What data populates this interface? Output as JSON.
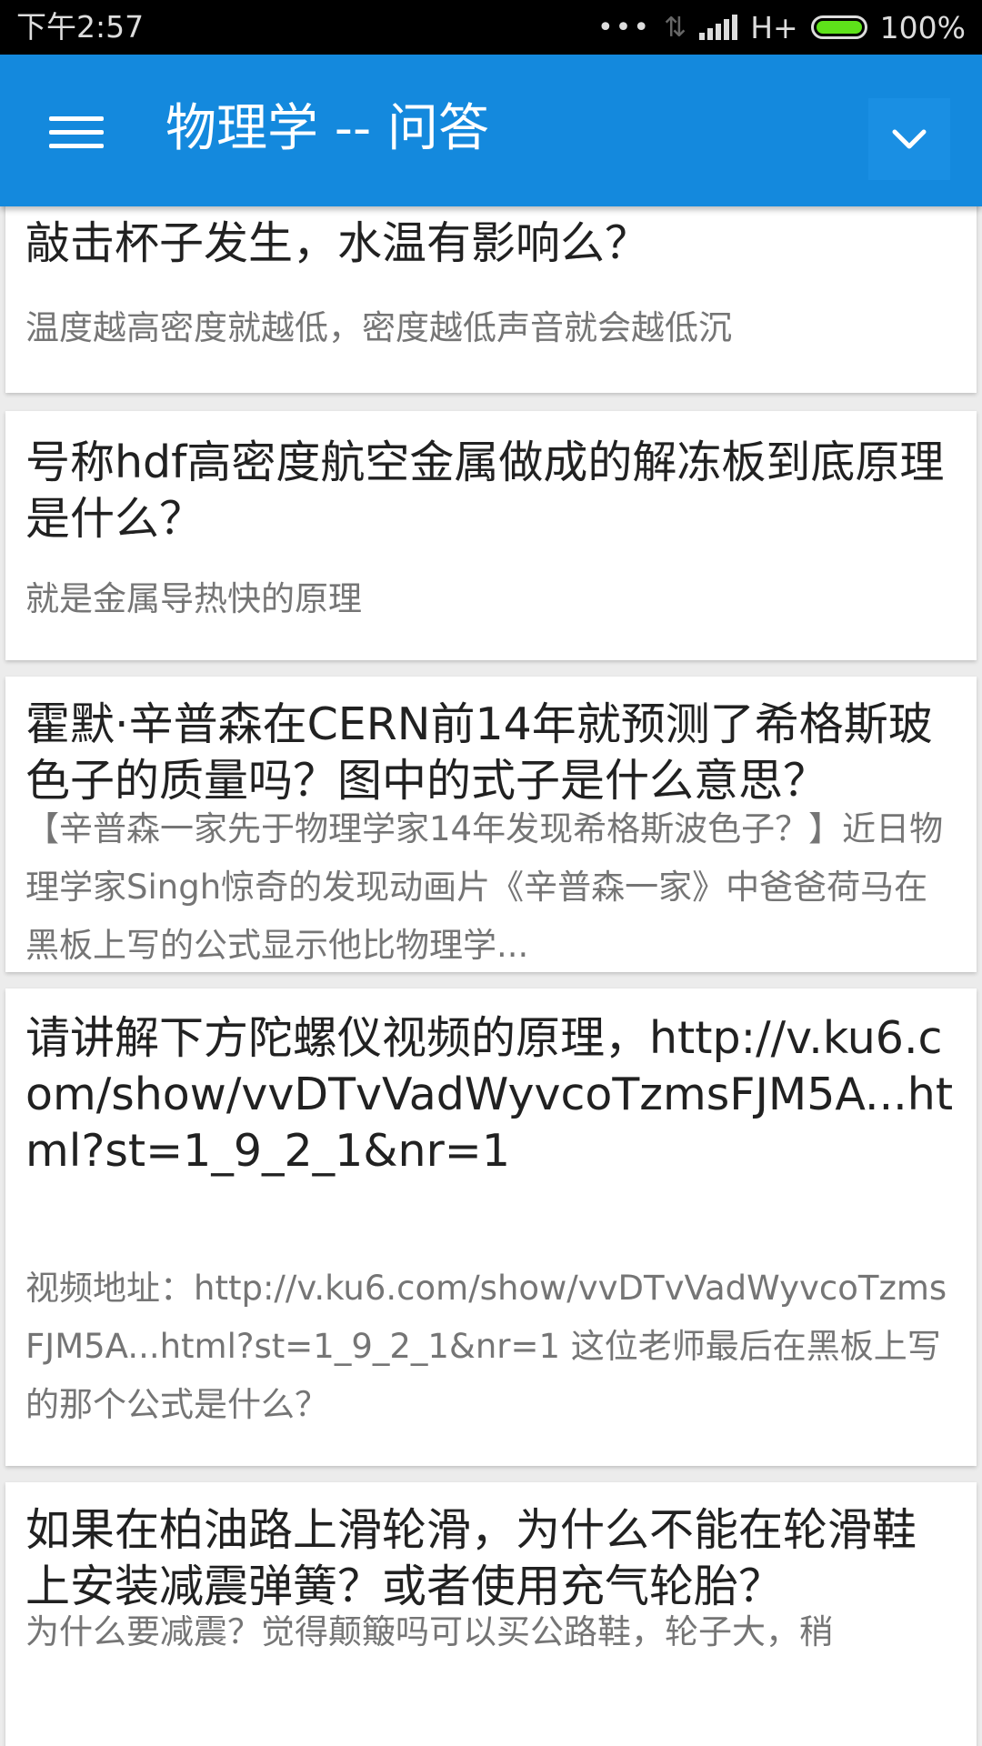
{
  "status_bar": {
    "time": "下午2:57",
    "network": "H+",
    "battery": "100%",
    "battery_level": 1.0
  },
  "app_bar": {
    "title": "物理学 -- 问答",
    "menu_icon": "hamburger-menu",
    "dropdown_icon": "chevron-down"
  },
  "questions": [
    {
      "title": "敲击杯子发生，水温有影响么？",
      "summary": "温度越高密度就越低，密度越低声音就会越低沉"
    },
    {
      "title": "号称hdf高密度航空金属做成的解冻板到底原理是什么？",
      "summary": "就是金属导热快的原理"
    },
    {
      "title": "霍默·辛普森在CERN前14年就预测了希格斯玻色子的质量吗？图中的式子是什么意思？",
      "summary": "【辛普森一家先于物理学家14年发现希格斯波色子？】近日物理学家Singh惊奇的发现动画片《辛普森一家》中爸爸荷马在黑板上写的公式显示他比物理学..."
    },
    {
      "title": "请讲解下方陀螺仪视频的原理，http://v.ku6.com/show/vvDTvVadWyvcoTzmsFJM5A...html?st=1_9_2_1&nr=1",
      "summary": "视频地址：http://v.ku6.com/show/vvDTvVadWyvcoTzmsFJM5A...html?st=1_9_2_1&nr=1 这位老师最后在黑板上写的那个公式是什么？"
    },
    {
      "title": "如果在柏油路上滑轮滑，为什么不能在轮滑鞋上安装减震弹簧？或者使用充气轮胎？",
      "summary": "为什么要减震？觉得颠簸吗可以买公路鞋，轮子大，稍"
    }
  ]
}
